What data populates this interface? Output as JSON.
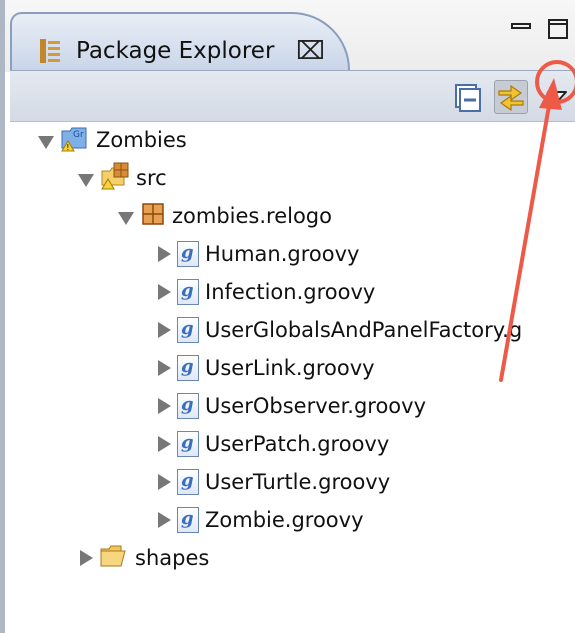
{
  "view": {
    "tab_title": "Package Explorer",
    "tab_icon": "package-explorer-icon",
    "close_icon": "close-icon",
    "controls": [
      "minimize-icon",
      "maximize-icon"
    ]
  },
  "toolbar": {
    "buttons": [
      {
        "name": "collapse-all-button",
        "icon": "collapse-all-icon"
      },
      {
        "name": "link-with-editor-button",
        "icon": "link-with-editor-icon",
        "pressed": true
      },
      {
        "name": "view-menu-button",
        "icon": "chevron-down-icon",
        "highlighted": true
      }
    ],
    "annotation_color": "#ee5a48"
  },
  "tree": {
    "project": "Zombies",
    "src": "src",
    "package": "zombies.relogo",
    "files": [
      "Human.groovy",
      "Infection.groovy",
      "UserGlobalsAndPanelFactory.g",
      "UserLink.groovy",
      "UserObserver.groovy",
      "UserPatch.groovy",
      "UserTurtle.groovy",
      "Zombie.groovy"
    ],
    "folder": "shapes"
  }
}
